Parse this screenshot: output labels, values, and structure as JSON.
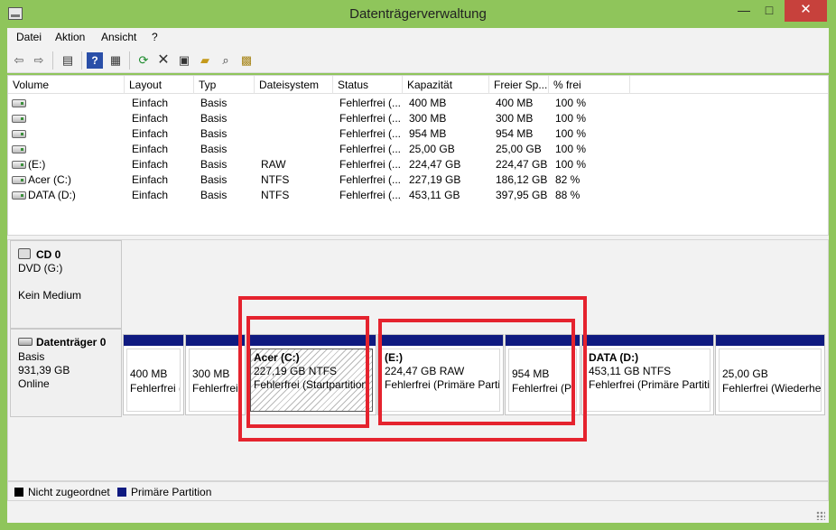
{
  "window": {
    "title": "Datenträgerverwaltung",
    "minimize": "—",
    "maximize": "□",
    "close": "✕"
  },
  "menu": [
    "Datei",
    "Aktion",
    "Ansicht",
    "?"
  ],
  "toolbar": [
    "back-icon",
    "forward-icon",
    "show-hide-console-tree-icon",
    "help-icon",
    "properties-icon",
    "refresh-icon",
    "delete-icon",
    "settings-icon",
    "open-icon",
    "explore-icon",
    "rescan-icon"
  ],
  "volumes": {
    "columns": [
      "Volume",
      "Layout",
      "Typ",
      "Dateisystem",
      "Status",
      "Kapazität",
      "Freier Sp...",
      "% frei"
    ],
    "rows": [
      {
        "volume": "",
        "layout": "Einfach",
        "typ": "Basis",
        "fs": "",
        "status": "Fehlerfrei (...",
        "capacity": "400 MB",
        "free": "400 MB",
        "pct": "100 %"
      },
      {
        "volume": "",
        "layout": "Einfach",
        "typ": "Basis",
        "fs": "",
        "status": "Fehlerfrei (...",
        "capacity": "300 MB",
        "free": "300 MB",
        "pct": "100 %"
      },
      {
        "volume": "",
        "layout": "Einfach",
        "typ": "Basis",
        "fs": "",
        "status": "Fehlerfrei (...",
        "capacity": "954 MB",
        "free": "954 MB",
        "pct": "100 %"
      },
      {
        "volume": "",
        "layout": "Einfach",
        "typ": "Basis",
        "fs": "",
        "status": "Fehlerfrei (...",
        "capacity": "25,00 GB",
        "free": "25,00 GB",
        "pct": "100 %"
      },
      {
        "volume": "(E:)",
        "layout": "Einfach",
        "typ": "Basis",
        "fs": "RAW",
        "status": "Fehlerfrei (...",
        "capacity": "224,47 GB",
        "free": "224,47 GB",
        "pct": "100 %"
      },
      {
        "volume": "Acer (C:)",
        "layout": "Einfach",
        "typ": "Basis",
        "fs": "NTFS",
        "status": "Fehlerfrei (...",
        "capacity": "227,19 GB",
        "free": "186,12 GB",
        "pct": "82 %"
      },
      {
        "volume": "DATA (D:)",
        "layout": "Einfach",
        "typ": "Basis",
        "fs": "NTFS",
        "status": "Fehlerfrei (...",
        "capacity": "453,11 GB",
        "free": "397,95 GB",
        "pct": "88 %"
      }
    ]
  },
  "cd": {
    "name": "CD 0",
    "drive": "DVD (G:)",
    "media": "Kein Medium"
  },
  "disk0": {
    "name": "Datenträger 0",
    "type": "Basis",
    "size": "931,39 GB",
    "state": "Online",
    "partitions": [
      {
        "title": "",
        "size": "400 MB",
        "status": "Fehlerfrei ("
      },
      {
        "title": "",
        "size": "300 MB",
        "status": "Fehlerfrei"
      },
      {
        "title": "Acer (C:)",
        "size": "227,19 GB NTFS",
        "status": "Fehlerfrei (Startpartition"
      },
      {
        "title": "(E:)",
        "size": "224,47 GB RAW",
        "status": "Fehlerfrei (Primäre Partit"
      },
      {
        "title": "",
        "size": "954 MB",
        "status": "Fehlerfrei (P"
      },
      {
        "title": "DATA (D:)",
        "size": "453,11 GB NTFS",
        "status": "Fehlerfrei (Primäre Partitio"
      },
      {
        "title": "",
        "size": "25,00 GB",
        "status": "Fehlerfrei (Wiederhe"
      }
    ]
  },
  "legend": [
    {
      "label": "Nicht zugeordnet",
      "color": "#000000"
    },
    {
      "label": "Primäre Partition",
      "color": "#0f1a80"
    }
  ],
  "colors": {
    "frame": "#8fc55b",
    "highlight": "#e5232e",
    "partition_bar": "#0f1a80",
    "close_button": "#c7413c"
  }
}
